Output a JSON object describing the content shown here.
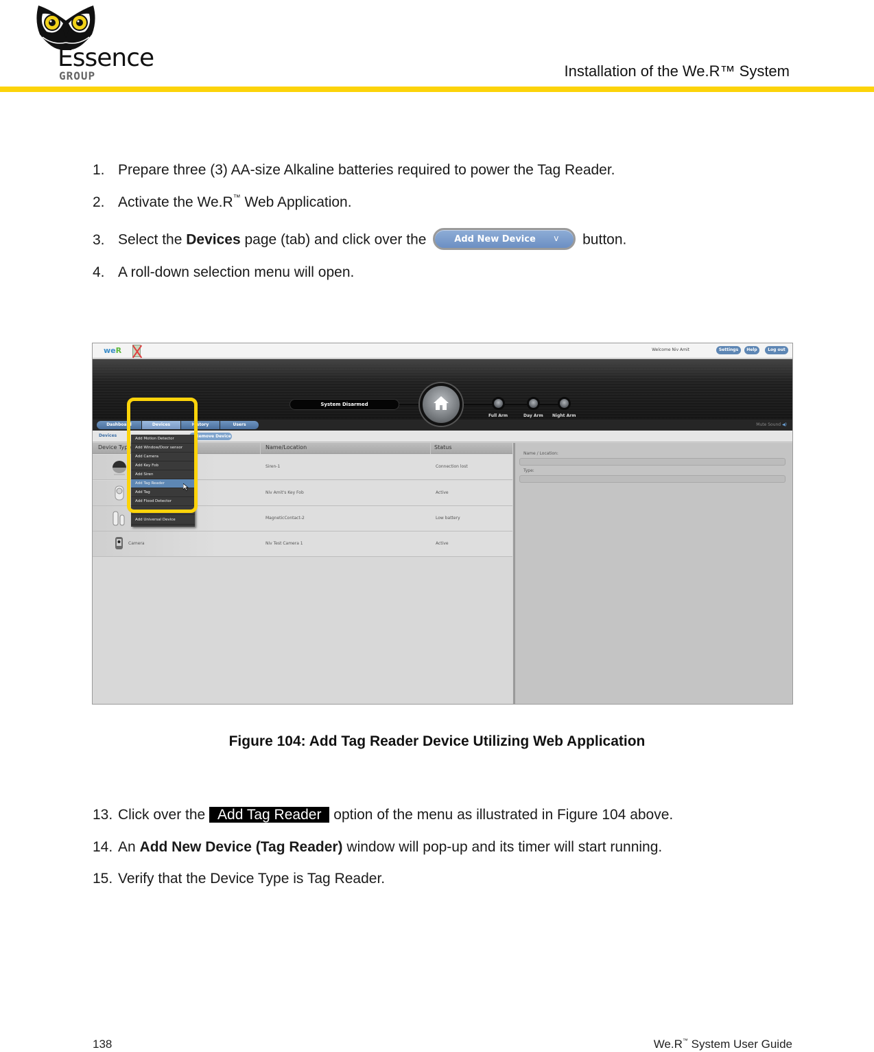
{
  "header": {
    "logo_word": "Essence",
    "logo_sub": "GROUP",
    "title": "Installation of the We.R™ System",
    "accent_color": "#fcd30a"
  },
  "steps_before": [
    {
      "num": "1.",
      "text": "Prepare three (3) AA-size Alkaline batteries required to power the Tag Reader."
    },
    {
      "num": "2.",
      "text_a": "Activate the We.R",
      "tm": "™",
      "text_b": " Web Application."
    },
    {
      "num": "3.",
      "text_a": "Select the ",
      "bold": "Devices",
      "text_b": " page (tab) and click over the ",
      "button_label": "Add New Device",
      "button_chevron": "v",
      "text_c": " button."
    },
    {
      "num": "4.",
      "text": "A roll-down selection menu will open."
    }
  ],
  "screenshot": {
    "app_logo_a": "we",
    "app_logo_b": "R",
    "welcome": "Welcome  Niv Amit",
    "top_buttons": [
      "Settings",
      "Help",
      "Log out"
    ],
    "system_status": "System Disarmed",
    "home_icon": "home-icon",
    "arm_modes": [
      "Full Arm",
      "Day Arm",
      "Night Arm"
    ],
    "nav_tabs": [
      {
        "label": "Dashboard",
        "active": false
      },
      {
        "label": "Devices",
        "active": true
      },
      {
        "label": "History",
        "active": false
      },
      {
        "label": "Users",
        "active": false
      }
    ],
    "mute_sound": "Mute Sound",
    "sub_devices": "Devices",
    "sub_remove": "Remove Device",
    "table": {
      "columns": [
        "Device Type",
        "Name/Location",
        "Status"
      ],
      "rows": [
        {
          "type": "Siren",
          "icon": "siren-icon",
          "name": "Siren-1",
          "status": "Connection lost"
        },
        {
          "type": "Key Fob",
          "icon": "key-fob-icon",
          "name": "Niv Amit's Key Fob",
          "status": "Active"
        },
        {
          "type": "Magnetic Contact",
          "icon": "magnetic-contact-icon",
          "name": "MagneticContact-2",
          "status": "Low battery"
        },
        {
          "type": "Camera",
          "icon": "camera-icon",
          "name": "Niv Test Camera 1",
          "status": "Active"
        }
      ]
    },
    "dropdown_items": [
      {
        "label": "Add Motion Detector",
        "selected": false
      },
      {
        "label": "Add Window/Door sensor",
        "selected": false
      },
      {
        "label": "Add Camera",
        "selected": false
      },
      {
        "label": "Add Key Fob",
        "selected": false
      },
      {
        "label": "Add Siren",
        "selected": false
      },
      {
        "label": "Add Tag Reader",
        "selected": true
      },
      {
        "label": "Add Tag",
        "selected": false
      },
      {
        "label": "Add Flood Detector",
        "selected": false
      },
      {
        "label": "",
        "selected": false
      },
      {
        "label": "Add Universal Device",
        "selected": false
      }
    ],
    "detail": {
      "name_label": "Name / Location:",
      "type_label": "Type:"
    }
  },
  "caption": "Figure 104: Add Tag Reader Device Utilizing Web Application",
  "steps_after": [
    {
      "num": "13.",
      "text_a": "Click over the ",
      "highlight": "Add Tag Reader",
      "text_b": " option of the menu as illustrated in Figure 104 above."
    },
    {
      "num": "14.",
      "text_a": "An ",
      "bold": "Add New Device (Tag Reader)",
      "text_b": " window will pop-up and its timer will start running."
    },
    {
      "num": "15.",
      "text": "Verify that the Device Type is Tag Reader."
    }
  ],
  "footer": {
    "page_number": "138",
    "guide_a": "We.R",
    "guide_tm": "™",
    "guide_b": " System User Guide"
  }
}
